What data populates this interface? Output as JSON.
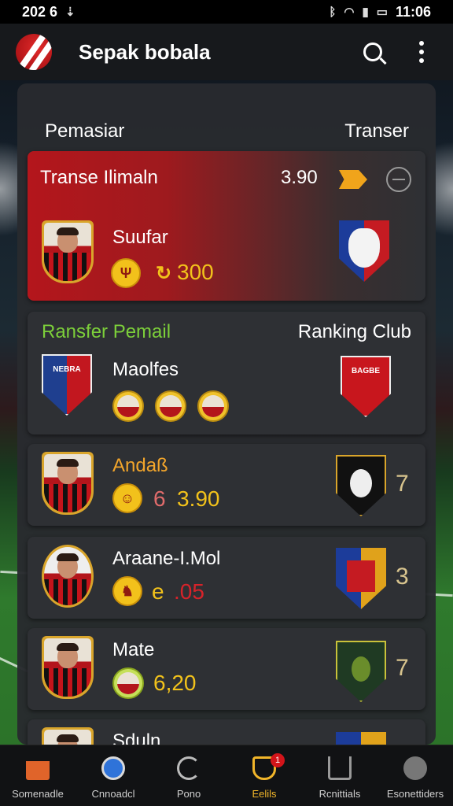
{
  "status_bar": {
    "time_left": "202 6",
    "time_right": "11:06"
  },
  "app": {
    "title": "Sepak bobala"
  },
  "panel": {
    "left_heading": "Pemasiar",
    "right_heading": "Transer"
  },
  "featured": {
    "title": "Transe Ilimaln",
    "amount": "3.90",
    "player_name": "Suufar",
    "value": "300",
    "crest_text": ""
  },
  "club_card": {
    "title": "Ransfer Pemail",
    "right_title": "Ranking Club",
    "name": "Maolfes",
    "crest_left": "NEBRA",
    "crest_right": "BAGBE"
  },
  "players": [
    {
      "name": "Andaß",
      "value": "3.90",
      "value_prefix": "6",
      "rank": "7",
      "name_color": "#f2a52b",
      "value_color": "#f2c21b"
    },
    {
      "name": "Araane-I.Mol",
      "value": ".05",
      "value_prefix": "e",
      "rank": "3",
      "name_color": "#ffffff",
      "value_color": "#d6232a"
    },
    {
      "name": "Mate",
      "value": "6,20",
      "value_prefix": "",
      "rank": "7",
      "name_color": "#ffffff",
      "value_color": "#f2c21b"
    },
    {
      "name": "Sduln",
      "value": "",
      "value_prefix": "",
      "rank": "",
      "name_color": "#ffffff",
      "value_color": "#f2c21b"
    }
  ],
  "bottom_nav": [
    {
      "label": "Somenadle",
      "icon": "inbox-icon"
    },
    {
      "label": "Cnnoadcl",
      "icon": "ball-icon"
    },
    {
      "label": "Pono",
      "icon": "refresh-icon"
    },
    {
      "label": "Eelils",
      "icon": "shield-icon",
      "badge": "1"
    },
    {
      "label": "Rcnittials",
      "icon": "stadium-icon"
    },
    {
      "label": "Esonettiders",
      "icon": "tools-icon"
    }
  ],
  "colors": {
    "accent": "#f1b52a",
    "featured_red": "#b4161c",
    "panel": "#282a2e"
  }
}
